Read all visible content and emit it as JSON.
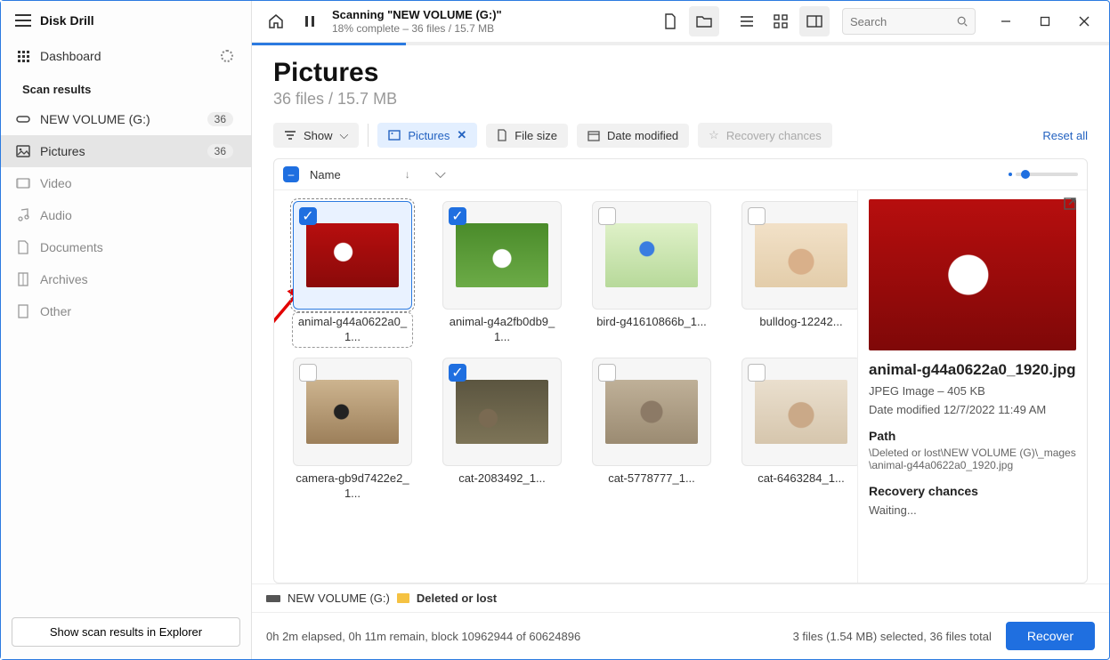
{
  "app": {
    "title": "Disk Drill"
  },
  "sidebar": {
    "dashboard": "Dashboard",
    "scan_results_header": "Scan results",
    "items": [
      {
        "label": "NEW VOLUME (G:)",
        "badge": "36"
      },
      {
        "label": "Pictures",
        "badge": "36"
      },
      {
        "label": "Video"
      },
      {
        "label": "Audio"
      },
      {
        "label": "Documents"
      },
      {
        "label": "Archives"
      },
      {
        "label": "Other"
      }
    ],
    "footer_button": "Show scan results in Explorer"
  },
  "titlebar": {
    "scan_title": "Scanning \"NEW VOLUME (G:)\"",
    "scan_sub": "18% complete – 36 files / 15.7 MB",
    "search_placeholder": "Search"
  },
  "page": {
    "title": "Pictures",
    "subtitle": "36 files / 15.7 MB"
  },
  "toolbar": {
    "show": "Show",
    "chips": {
      "pictures": "Pictures",
      "file_size": "File size",
      "date_modified": "Date modified",
      "recovery_chances": "Recovery chances"
    },
    "reset": "Reset all"
  },
  "gridhead": {
    "name_col": "Name"
  },
  "files": [
    {
      "name": "animal-g44a0622a0_1...",
      "checked": true,
      "selected": true,
      "thumb": "th1"
    },
    {
      "name": "animal-g4a2fb0db9_1...",
      "checked": true,
      "thumb": "th2"
    },
    {
      "name": "bird-g41610866b_1...",
      "thumb": "th3"
    },
    {
      "name": "bulldog-12242...",
      "thumb": "th4"
    },
    {
      "name": "camera-gb9d7422e2_1...",
      "thumb": "th5"
    },
    {
      "name": "cat-2083492_1...",
      "checked": true,
      "thumb": "th6"
    },
    {
      "name": "cat-5778777_1...",
      "thumb": "th7"
    },
    {
      "name": "cat-6463284_1...",
      "thumb": "th8"
    }
  ],
  "preview": {
    "filename": "animal-g44a0622a0_1920.jpg",
    "meta": "JPEG Image – 405 KB",
    "modified": "Date modified 12/7/2022 11:49 AM",
    "path_header": "Path",
    "path": "\\Deleted or lost\\NEW VOLUME (G)\\_mages\\animal-g44a0622a0_1920.jpg",
    "chances_header": "Recovery chances",
    "chances_value": "Waiting..."
  },
  "breadcrumb": {
    "drive": "NEW VOLUME (G:)",
    "folder": "Deleted or lost"
  },
  "status": {
    "elapsed": "0h 2m elapsed, 0h 11m remain, block 10962944 of 60624896",
    "selection": "3 files (1.54 MB) selected, 36 files total",
    "recover": "Recover"
  }
}
